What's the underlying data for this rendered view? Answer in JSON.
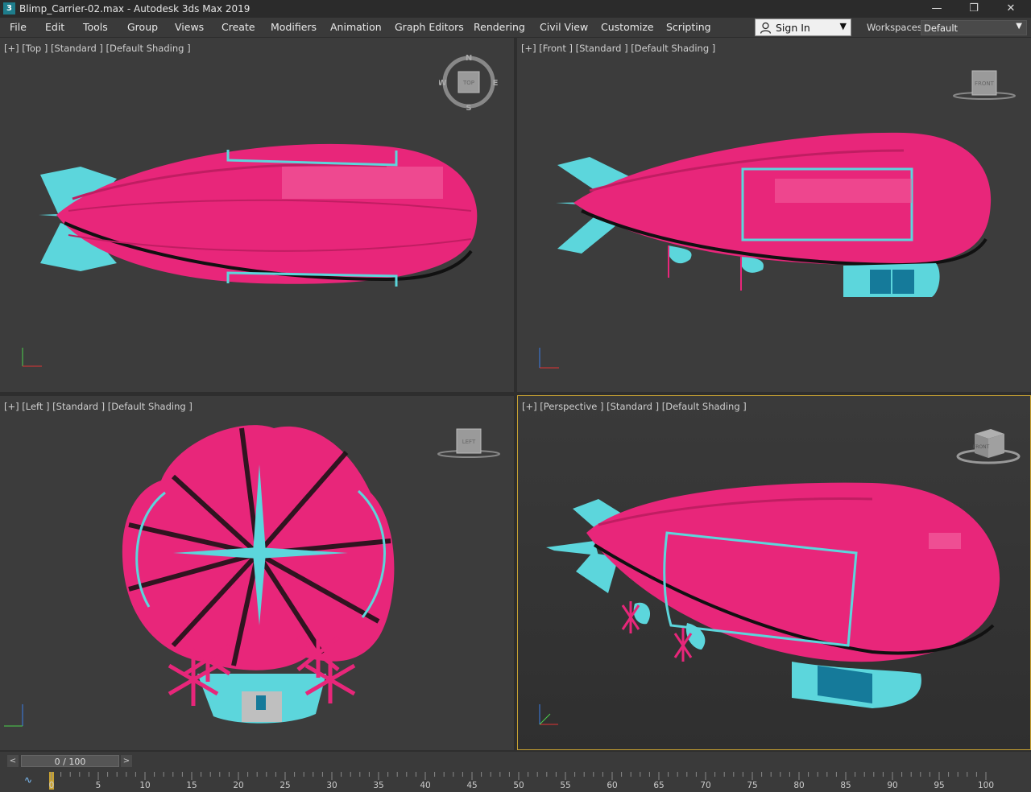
{
  "window": {
    "app_icon": "3",
    "title": "Blimp_Carrier-02.max - Autodesk 3ds Max 2019",
    "controls": [
      "minimize-icon",
      "restore-icon",
      "close-icon"
    ]
  },
  "menubar": {
    "items": [
      "File",
      "Edit",
      "Tools",
      "Group",
      "Views",
      "Create",
      "Modifiers",
      "Animation",
      "Graph Editors",
      "Rendering",
      "Civil View",
      "Customize",
      "Scripting"
    ],
    "overflow": "»"
  },
  "account": {
    "sign_in_label": "Sign In",
    "user_icon": "user-icon"
  },
  "workspaces": {
    "label": "Workspaces:",
    "value": "Default"
  },
  "viewports": [
    {
      "label": "[+] [Top ] [Standard ] [Default Shading ]",
      "gizmo": "TOP",
      "compass": [
        "N",
        "S",
        "E",
        "W"
      ]
    },
    {
      "label": "[+] [Front ] [Standard ] [Default Shading ]",
      "gizmo": "FRONT"
    },
    {
      "label": "[+] [Left ] [Standard ] [Default Shading ]",
      "gizmo": "LEFT"
    },
    {
      "label": "[+] [Perspective ] [Standard ] [Default Shading ]",
      "gizmo": "FRONT",
      "active": true
    }
  ],
  "timeline": {
    "frame_display": "0 / 100",
    "ticks": [
      "0",
      "5",
      "10",
      "15",
      "20",
      "25",
      "30",
      "35",
      "40",
      "45",
      "50",
      "55",
      "60",
      "65",
      "70",
      "75",
      "80",
      "85",
      "90",
      "95",
      "100"
    ]
  },
  "colors": {
    "blimp_pink": "#e8267a",
    "accent_cyan": "#5cd6dc",
    "active_border": "#c8a232",
    "viewport_bg": "#3c3c3c"
  }
}
